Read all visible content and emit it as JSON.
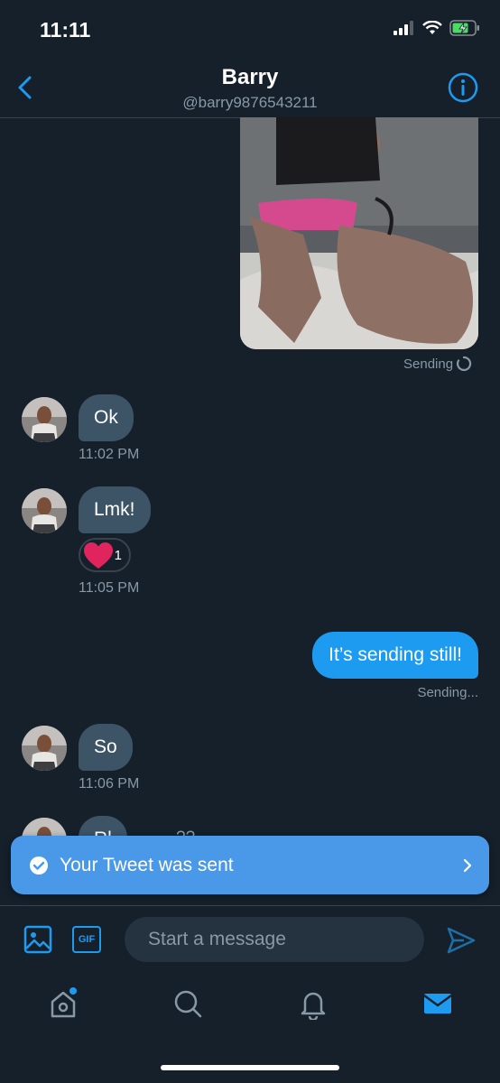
{
  "status_bar": {
    "time": "11:11"
  },
  "header": {
    "title": "Barry",
    "handle": "@barry9876543211"
  },
  "messages": {
    "photo_status": "Sending",
    "ok": {
      "text": "Ok",
      "time": "11:02 PM"
    },
    "lmk": {
      "text": "Lmk!",
      "time": "11:05 PM",
      "reaction_count": "1"
    },
    "sent": {
      "text": "It’s sending still!",
      "status": "Sending..."
    },
    "so": {
      "text": "So",
      "time": "11:06 PM"
    },
    "partial": {
      "text": "Rl",
      "tail": "??"
    }
  },
  "toast": {
    "text": "Your Tweet was sent"
  },
  "composer": {
    "placeholder": "Start a message",
    "gif_label": "GIF"
  },
  "colors": {
    "background": "#15202b",
    "accent": "#1d9bf0",
    "incoming_bubble": "#3d5466",
    "toast": "#4a99e9",
    "reaction_heart": "#e0245e"
  },
  "tabbar": {
    "items": [
      "home-icon",
      "search-icon",
      "notifications-icon",
      "messages-icon"
    ]
  }
}
